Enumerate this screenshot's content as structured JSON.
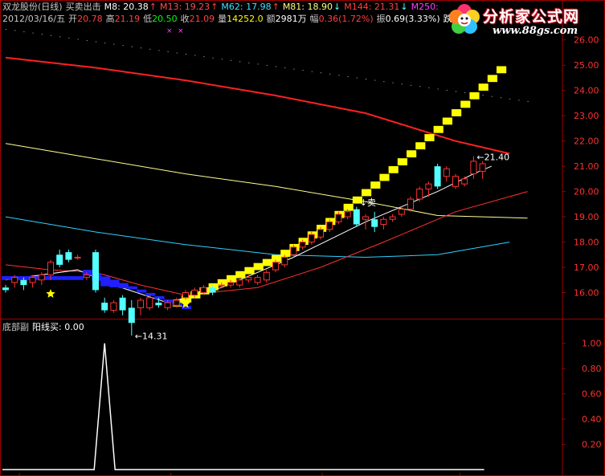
{
  "header": {
    "title": "双龙股份(日线)",
    "indicator": "买卖出击",
    "mas": [
      {
        "label": "M8: 20.38",
        "arrow": "↑",
        "color": "#ffffff"
      },
      {
        "label": "M13: 19.23",
        "arrow": "↑",
        "color": "#ff5050"
      },
      {
        "label": "M62: 17.98",
        "arrow": "↑",
        "color": "#40e0ff"
      },
      {
        "label": "M81: 18.90",
        "arrow": "↓",
        "color": "#ffff80"
      },
      {
        "label": "M144: 21.31",
        "arrow": "↓",
        "color": "#ff4040"
      },
      {
        "label": "M250:",
        "arrow": "",
        "color": "#ff40ff"
      }
    ],
    "date": "2012/03/16/五",
    "ohlc": [
      {
        "label": "开",
        "value": "20.78",
        "color": "#ff4040"
      },
      {
        "label": "高",
        "value": "21.19",
        "color": "#ff4040"
      },
      {
        "label": "低",
        "value": "20.50",
        "color": "#00ff00"
      },
      {
        "label": "收",
        "value": "21.09",
        "color": "#ff4040"
      },
      {
        "label": "量",
        "value": "14252.0",
        "color": "#ffff00"
      },
      {
        "label": "额",
        "value": "2981万",
        "color": "#ffffff"
      },
      {
        "label": "幅",
        "value": "0.36",
        "color": "#ff4040",
        "suffix": "(1.72%)"
      },
      {
        "label": "振",
        "value": "0.69(3.33%)",
        "color": "#ffffff"
      }
    ],
    "row2_tail": "跌"
  },
  "logo": {
    "name": "分析家公式网",
    "url": "www.88gs.com"
  },
  "colors": {
    "up": "#ff3232",
    "down": "#54ffff",
    "ma144": "#ff2020",
    "ma81": "#ffff90",
    "ma62": "#30d0ff",
    "ma13": "#ff3030",
    "ma8": "#ffffff",
    "axis": "#a00000",
    "band": "#ffff00",
    "blueband": "#2020ff"
  },
  "chart_data": [
    {
      "type": "candlestick",
      "title": "双龙股份(日线) 买卖出击",
      "ylim": [
        15.0,
        26.5
      ],
      "ticks": [
        "16.00",
        "17.00",
        "18.00",
        "19.00",
        "20.00",
        "21.00",
        "22.00",
        "23.00",
        "24.00",
        "25.00",
        "26.00"
      ],
      "tick_values": [
        16,
        17,
        18,
        19,
        20,
        21,
        22,
        23,
        24,
        25,
        26
      ],
      "annotations": [
        {
          "text": "14.31",
          "bar": 14,
          "value": 14.31
        },
        {
          "text": "21.40",
          "bar": 52,
          "value": 21.4
        },
        {
          "text": "↓卖",
          "bar": 39,
          "value": 19.6
        }
      ],
      "stars": [
        {
          "bar": 5,
          "value": 15.95
        },
        {
          "bar": 20,
          "value": 15.55
        }
      ],
      "candles": [
        [
          16.2,
          16.3,
          16.0,
          16.1
        ],
        [
          16.4,
          16.7,
          16.2,
          16.6
        ],
        [
          16.5,
          16.6,
          16.1,
          16.3
        ],
        [
          16.4,
          16.7,
          16.2,
          16.6
        ],
        [
          16.5,
          16.8,
          16.3,
          16.7
        ],
        [
          16.7,
          17.3,
          16.5,
          17.2
        ],
        [
          17.5,
          17.7,
          17.0,
          17.1
        ],
        [
          17.6,
          17.7,
          17.2,
          17.3
        ],
        [
          17.4,
          17.5,
          17.3,
          17.4
        ],
        [
          16.6,
          16.8,
          16.5,
          16.7
        ],
        [
          17.6,
          17.7,
          16.0,
          16.1
        ],
        [
          15.6,
          15.8,
          15.2,
          15.3
        ],
        [
          15.3,
          15.7,
          15.2,
          15.6
        ],
        [
          15.8,
          15.9,
          15.1,
          15.3
        ],
        [
          15.4,
          15.7,
          14.3,
          14.8
        ],
        [
          15.4,
          15.8,
          15.1,
          15.7
        ],
        [
          15.4,
          15.9,
          15.3,
          15.8
        ],
        [
          15.6,
          15.8,
          15.4,
          15.5
        ],
        [
          15.4,
          15.7,
          15.3,
          15.6
        ],
        [
          15.5,
          15.8,
          15.4,
          15.7
        ],
        [
          15.8,
          16.1,
          15.6,
          16.0
        ],
        [
          15.9,
          16.2,
          15.8,
          16.1
        ],
        [
          16.0,
          16.3,
          15.9,
          16.2
        ],
        [
          16.2,
          16.3,
          15.9,
          16.0
        ],
        [
          16.3,
          16.4,
          16.2,
          16.3
        ],
        [
          16.3,
          16.5,
          16.2,
          16.4
        ],
        [
          16.3,
          16.6,
          16.2,
          16.5
        ],
        [
          16.5,
          16.7,
          16.4,
          16.6
        ],
        [
          16.4,
          16.7,
          16.3,
          16.6
        ],
        [
          16.5,
          16.9,
          16.4,
          16.8
        ],
        [
          16.9,
          17.3,
          16.8,
          17.2
        ],
        [
          17.1,
          17.5,
          17.0,
          17.4
        ],
        [
          17.5,
          17.9,
          17.4,
          17.8
        ],
        [
          17.8,
          18.1,
          17.7,
          18.0
        ],
        [
          18.0,
          18.4,
          17.9,
          18.3
        ],
        [
          18.2,
          18.6,
          18.1,
          18.5
        ],
        [
          18.5,
          18.9,
          18.4,
          18.8
        ],
        [
          18.8,
          19.2,
          18.7,
          19.1
        ],
        [
          19.0,
          19.3,
          18.9,
          19.2
        ],
        [
          19.3,
          19.4,
          18.6,
          18.7
        ],
        [
          18.9,
          19.1,
          18.5,
          19.0
        ],
        [
          18.9,
          19.2,
          18.4,
          18.6
        ],
        [
          18.7,
          19.0,
          18.5,
          18.9
        ],
        [
          18.9,
          19.1,
          18.8,
          19.0
        ],
        [
          19.1,
          19.4,
          19.0,
          19.3
        ],
        [
          19.3,
          19.8,
          19.2,
          19.7
        ],
        [
          19.7,
          20.2,
          19.6,
          20.1
        ],
        [
          20.1,
          20.4,
          19.8,
          20.3
        ],
        [
          21.0,
          21.1,
          20.1,
          20.2
        ],
        [
          20.6,
          21.0,
          20.4,
          20.9
        ],
        [
          20.2,
          20.7,
          20.1,
          20.6
        ],
        [
          20.3,
          20.6,
          20.2,
          20.5
        ],
        [
          20.7,
          21.4,
          20.5,
          21.2
        ],
        [
          20.8,
          21.2,
          20.5,
          21.1
        ]
      ],
      "ma144": [
        [
          0,
          25.3
        ],
        [
          10,
          24.9
        ],
        [
          20,
          24.4
        ],
        [
          30,
          23.8
        ],
        [
          40,
          23.1
        ],
        [
          50,
          22.0
        ],
        [
          56,
          21.5
        ]
      ],
      "ma81": [
        [
          0,
          21.9
        ],
        [
          10,
          21.3
        ],
        [
          20,
          20.7
        ],
        [
          30,
          20.2
        ],
        [
          40,
          19.6
        ],
        [
          48,
          19.05
        ],
        [
          58,
          18.95
        ]
      ],
      "ma62": [
        [
          0,
          19.0
        ],
        [
          10,
          18.4
        ],
        [
          20,
          17.9
        ],
        [
          30,
          17.5
        ],
        [
          40,
          17.4
        ],
        [
          48,
          17.5
        ],
        [
          56,
          18.0
        ]
      ],
      "ma13": [
        [
          0,
          17.1
        ],
        [
          5,
          16.9
        ],
        [
          10,
          16.8
        ],
        [
          15,
          16.3
        ],
        [
          20,
          15.9
        ],
        [
          28,
          16.2
        ],
        [
          35,
          17.0
        ],
        [
          42,
          18.0
        ],
        [
          50,
          19.2
        ],
        [
          58,
          20.0
        ]
      ],
      "ma8": [
        [
          0,
          16.5
        ],
        [
          8,
          16.9
        ],
        [
          12,
          16.3
        ],
        [
          18,
          15.6
        ],
        [
          24,
          16.2
        ],
        [
          32,
          17.4
        ],
        [
          40,
          18.8
        ],
        [
          48,
          20.0
        ],
        [
          52,
          20.7
        ],
        [
          54,
          21.0
        ]
      ]
    },
    {
      "type": "line",
      "title": "底部副",
      "series_label": "阳线买: 0.00",
      "ylim": [
        0.0,
        1.1
      ],
      "ticks": [
        "0.20",
        "0.40",
        "0.60",
        "0.80",
        "1.00"
      ],
      "tick_values": [
        0.2,
        0.4,
        0.6,
        0.8,
        1.0
      ],
      "pulse_bar": 11,
      "values_note": "0 everywhere except 1 at bar 11"
    }
  ]
}
